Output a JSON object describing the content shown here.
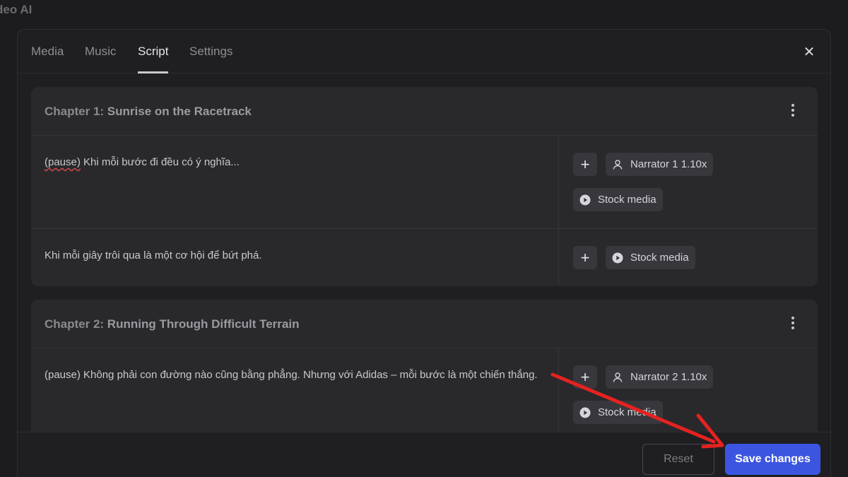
{
  "app": {
    "title": "deo AI"
  },
  "tabs": [
    {
      "label": "Media"
    },
    {
      "label": "Music"
    },
    {
      "label": "Script"
    },
    {
      "label": "Settings"
    }
  ],
  "active_tab": "Script",
  "close_symbol": "✕",
  "chapters": [
    {
      "prefix": "Chapter 1:",
      "name": " Sunrise on the Racetrack",
      "rows": [
        {
          "marker": "(pause)",
          "text": " Khi mỗi bước đi đều có ý nghĩa...",
          "narrator": "Narrator 1 1.10x",
          "stock": "Stock media"
        },
        {
          "text": "Khi mỗi giây trôi qua là một cơ hội để bứt phá.",
          "stock": "Stock media"
        }
      ]
    },
    {
      "prefix": "Chapter 2:",
      "name": " Running Through Difficult Terrain",
      "rows": [
        {
          "text": "(pause) Không phải con đường nào cũng bằng phẳng. Nhưng với Adidas – mỗi bước là một chiến thắng.",
          "narrator": "Narrator 2 1.10x",
          "stock": "Stock media"
        }
      ]
    }
  ],
  "footer": {
    "reset_label": "Reset",
    "save_label": "Save changes"
  },
  "colors": {
    "accent": "#3c55e0",
    "annotation_arrow": "#e5221f"
  },
  "icons": {
    "plus": "+",
    "kebab": "more-vertical-icon",
    "narrator": "user-icon",
    "stock": "play-circle-icon"
  }
}
